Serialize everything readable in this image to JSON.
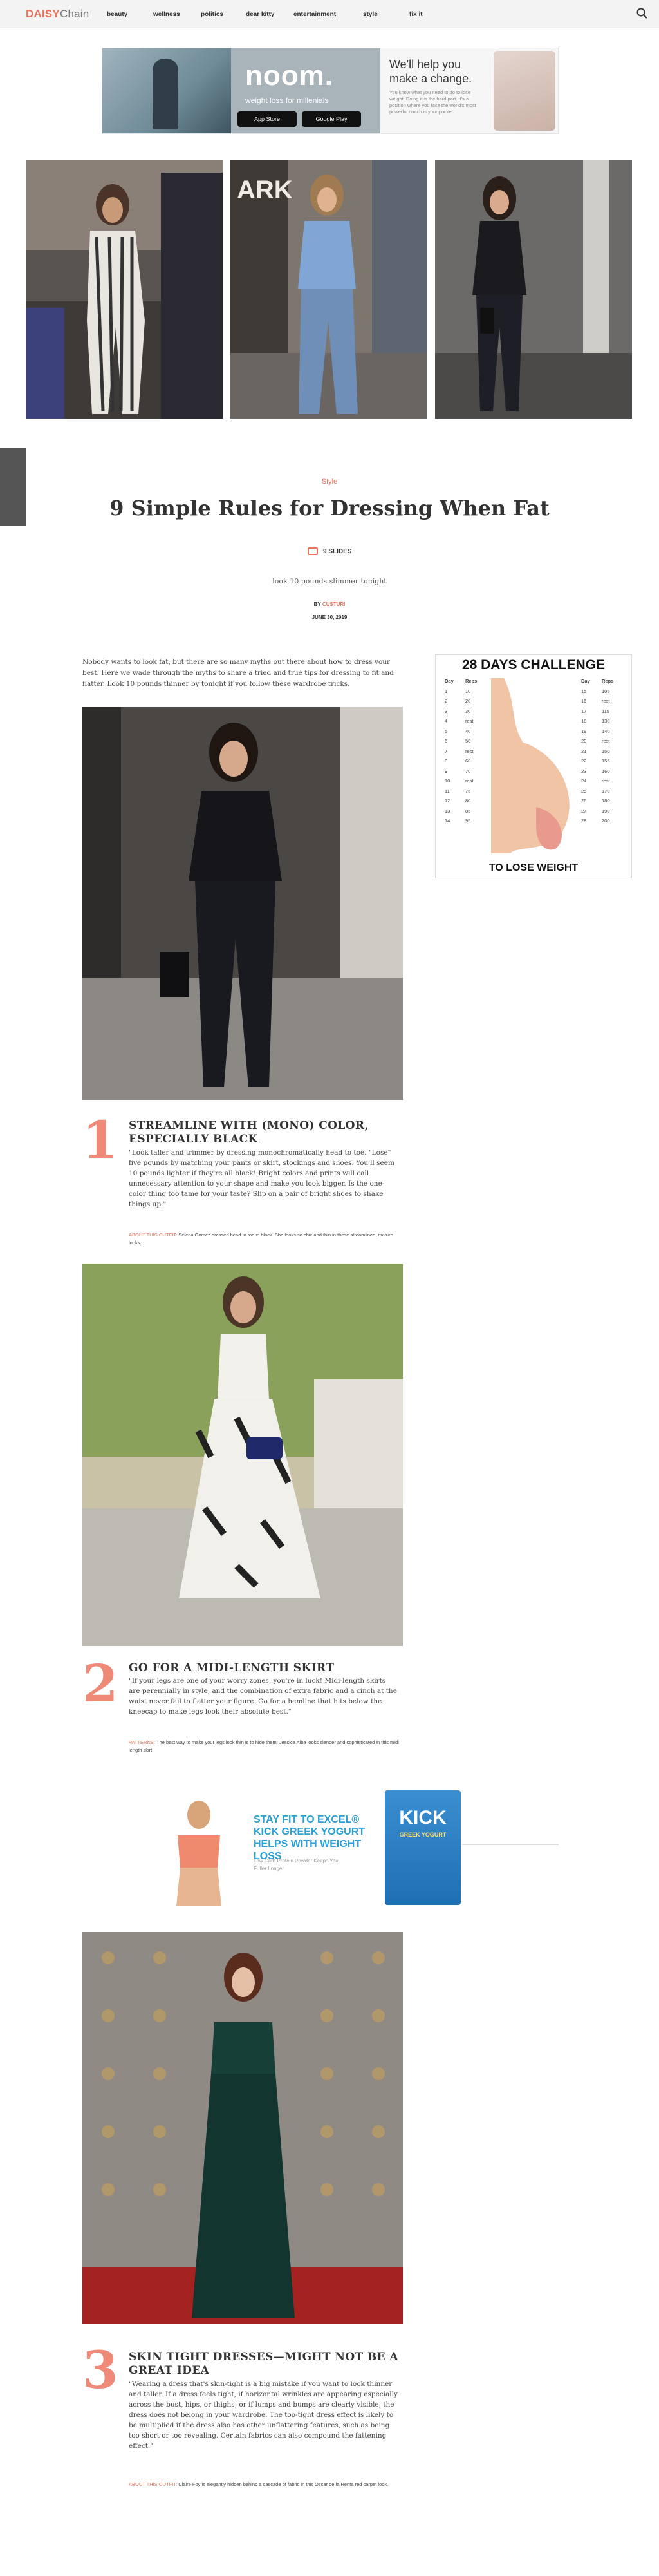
{
  "header": {
    "logo_part1": "DAISY",
    "logo_part2": "Chain",
    "nav": [
      "beauty",
      "wellness",
      "politics",
      "dear kitty",
      "entertainment",
      "style",
      "fix it"
    ]
  },
  "top_ad": {
    "brand": "noom.",
    "tagline": "weight loss for millenials",
    "app_store": "App Store",
    "google_play": "Google Play",
    "headline": "We'll help you make a change.",
    "body": "You know what you need to do to lose weight. Doing it is the hard part. It's a position where you face the world's most powerful coach is your pocket."
  },
  "article": {
    "category": "Style",
    "title": "9 Simple Rules for Dressing When Fat",
    "slides_label": "9 SLIDES",
    "subtitle": "look 10 pounds slimmer tonight",
    "by_label": "BY",
    "author": "CUSTURI",
    "date": "JUNE 30, 2019",
    "intro": "Nobody wants to look fat, but there are so many myths out there about how to dress your best. Here we wade through the myths to share a tried and true tips for dressing to fit and flatter. Look 10 pounds thinner by tonight if you follow these wardrobe tricks."
  },
  "side_ad": {
    "headline": "28 DAYS CHALLENGE",
    "footer": "TO LOSE WEIGHT",
    "col_day": "Day",
    "col_reps": "Reps",
    "left_days": [
      "1",
      "2",
      "3",
      "4",
      "5",
      "6",
      "7",
      "8",
      "9",
      "10",
      "11",
      "12",
      "13",
      "14"
    ],
    "left_reps": [
      "10",
      "20",
      "30",
      "rest",
      "40",
      "50",
      "rest",
      "60",
      "70",
      "rest",
      "75",
      "80",
      "85",
      "95"
    ],
    "right_days": [
      "15",
      "16",
      "17",
      "18",
      "19",
      "20",
      "21",
      "22",
      "23",
      "24",
      "25",
      "26",
      "27",
      "28"
    ],
    "right_reps": [
      "105",
      "rest",
      "115",
      "130",
      "140",
      "rest",
      "150",
      "155",
      "160",
      "rest",
      "170",
      "180",
      "190",
      "200"
    ]
  },
  "slides": [
    {
      "number": "1",
      "title": "STREAMLINE WITH (MONO) COLOR, ESPECIALLY BLACK",
      "text": "\"Look taller and trimmer by dressing monochromatically head to toe. \"Lose\" five pounds by matching your pants or skirt, stockings and shoes. You'll seem 10 pounds lighter if they're all black! Bright colors and prints will call unnecessary attention to your shape and make you look bigger. Is the one-color thing too tame for your taste? Slip on a pair of bright shoes to shake things up.\"",
      "credit_label": "ABOUT THIS OUTFIT:",
      "credit_text": "Selena Gomez dressed head to toe in black. She looks so chic and thin in these streamlined, mature looks."
    },
    {
      "number": "2",
      "title": "GO FOR A MIDI-LENGTH SKIRT",
      "text": "\"If your legs are one of your worry zones, you're in luck! Midi-length skirts are perennially in style, and the combination of extra fabric and a cinch at the waist never fail to flatter your figure. Go for a hemline that hits below the kneecap to make legs look their absolute best.\"",
      "credit_label": "PATTERNS:",
      "credit_text": "The best way to make your legs look thin is to hide them! Jessica Alba looks slender and sophisticated in this midi length skirt."
    },
    {
      "number": "3",
      "title": "SKIN TIGHT DRESSES—MIGHT NOT BE A GREAT IDEA",
      "text": "\"Wearing a dress that's skin-tight is a big mistake if you want to look thinner and taller. If a dress feels tight, if horizontal wrinkles are appearing especially across the bust, hips, or thighs, or if lumps and bumps are clearly visible, the dress does not belong in your wardrobe. The too-tight dress effect is likely to be multiplied if the dress also has other unflattering features, such as being too short or too revealing. Certain fabrics can also compound the fattening effect.\"",
      "credit_label": "ABOUT THIS OUTFIT:",
      "credit_text": "Claire Foy is elegantly hidden behind a cascade of fabric in this Oscar de la Renta red carpet look."
    }
  ],
  "mid_ad": {
    "headline": "STAY FIT TO EXCEL® KICK GREEK YOGURT HELPS WITH WEIGHT LOSS",
    "body": "Low Carb Protein Powder Keeps You Fuller Longer",
    "brand": "KICK",
    "product": "GREEK YOGURT"
  },
  "colors": {
    "accent": "#e9735e",
    "number": "#ef8a78"
  }
}
